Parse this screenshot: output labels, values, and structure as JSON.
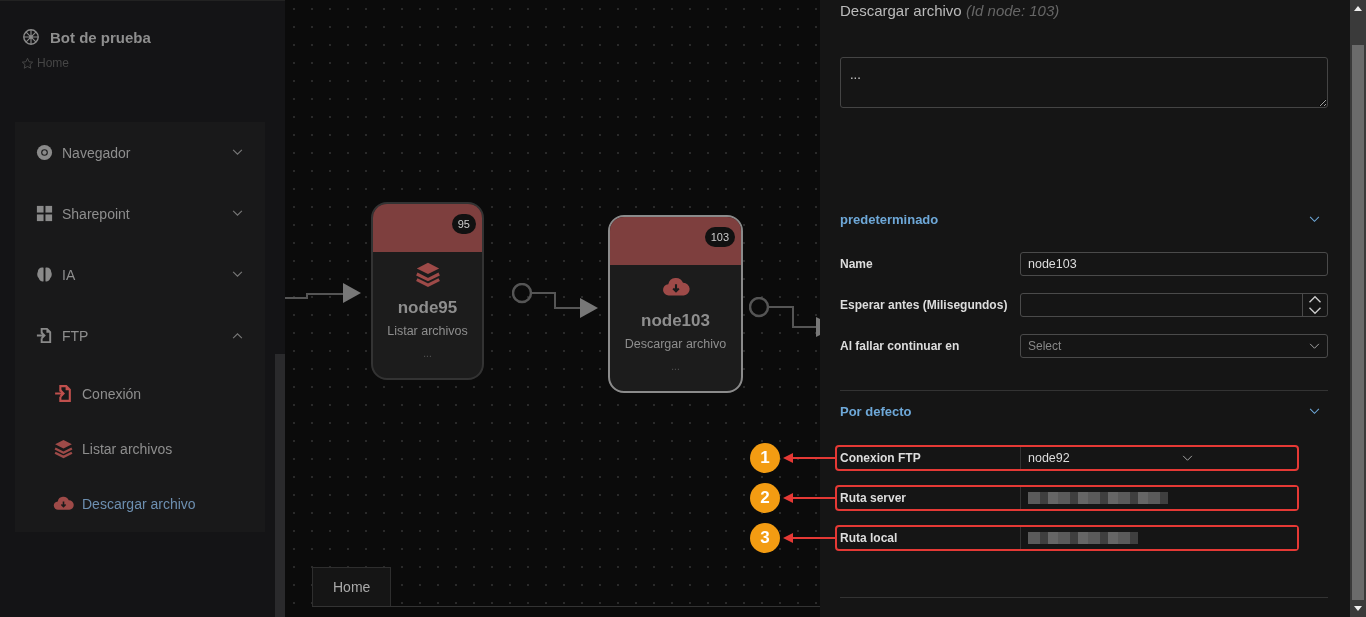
{
  "sidebar": {
    "title": "Bot de prueba",
    "breadcrumb": "Home",
    "items": [
      {
        "label": "Navegador",
        "expanded": false,
        "selected": false
      },
      {
        "label": "Sharepoint",
        "expanded": false,
        "selected": false
      },
      {
        "label": "IA",
        "expanded": false,
        "selected": false
      },
      {
        "label": "FTP",
        "expanded": true,
        "selected": false,
        "children": [
          {
            "label": "Conexión",
            "selected": false
          },
          {
            "label": "Listar archivos",
            "selected": false
          },
          {
            "label": "Descargar archivo",
            "selected": true
          }
        ]
      }
    ]
  },
  "canvas": {
    "nodes": [
      {
        "name": "node95",
        "type": "Listar archivos",
        "badge": "95",
        "footer": "...",
        "selected": false
      },
      {
        "name": "node103",
        "type": "Descargar archivo",
        "badge": "103",
        "footer": "...",
        "selected": true
      }
    ],
    "tabs": [
      {
        "label": "Home",
        "selected": true
      }
    ]
  },
  "panel": {
    "title": "Descargar archivo",
    "subtitle": "(Id node: 103)",
    "description": "...",
    "sections": [
      {
        "title": "predeterminado",
        "expanded": true,
        "fields": [
          {
            "label": "Name",
            "kind": "text",
            "value": "node103",
            "highlighted": false
          },
          {
            "label": "Esperar antes (Milisegundos)",
            "kind": "number",
            "highlighted": false
          },
          {
            "label": "Al fallar continuar en",
            "kind": "select",
            "placeholder": "Select",
            "highlighted": false
          }
        ]
      },
      {
        "title": "Por defecto",
        "expanded": true,
        "fields": [
          {
            "label": "Conexion FTP",
            "kind": "select",
            "value": "node92",
            "highlighted": true,
            "callout": "1"
          },
          {
            "label": "Ruta server",
            "kind": "redacted",
            "highlighted": true,
            "callout": "2"
          },
          {
            "label": "Ruta local",
            "kind": "redacted",
            "highlighted": true,
            "callout": "3"
          }
        ]
      }
    ]
  }
}
